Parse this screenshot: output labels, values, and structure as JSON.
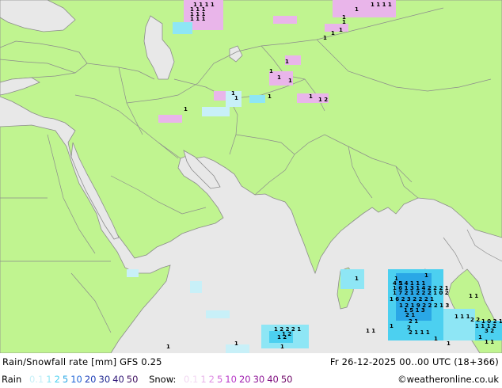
{
  "footer": {
    "title": "Rain/Snowfall rate [mm] GFS 0.25",
    "valid_time": "Fr 26-12-2025 00..00 UTC (18+366)",
    "credit": "©weatheronline.co.uk",
    "rain_label": "Rain",
    "snow_label": "Snow:",
    "rain_scale": [
      {
        "t": "0.1",
        "c": "#c8f0f8"
      },
      {
        "t": "1",
        "c": "#8ee6f5"
      },
      {
        "t": "2",
        "c": "#4cd0f0"
      },
      {
        "t": "5",
        "c": "#2aa7e6"
      },
      {
        "t": "10",
        "c": "#2166d8"
      },
      {
        "t": "20",
        "c": "#2040b8"
      },
      {
        "t": "30",
        "c": "#202890"
      },
      {
        "t": "40",
        "c": "#301878"
      },
      {
        "t": "50",
        "c": "#401060"
      }
    ],
    "snow_scale": [
      {
        "t": "0.1",
        "c": "#f2d8f2"
      },
      {
        "t": "1",
        "c": "#e9b5ea"
      },
      {
        "t": "2",
        "c": "#e090e4"
      },
      {
        "t": "5",
        "c": "#d060d8"
      },
      {
        "t": "10",
        "c": "#b838c8"
      },
      {
        "t": "20",
        "c": "#a020b0"
      },
      {
        "t": "30",
        "c": "#901898"
      },
      {
        "t": "40",
        "c": "#801080"
      },
      {
        "t": "50",
        "c": "#700868"
      }
    ]
  },
  "map": {
    "land_color": "#c0f490",
    "sea_color": "#e8e8e8",
    "border_color": "#8c8c8c",
    "precip_values": [
      "1 1 1 1",
      "1 1 1",
      "1 1 1",
      "1 1 1",
      "1 1 1 1",
      "1",
      "1",
      "1",
      "1",
      "1",
      "1",
      "1",
      "1",
      "1",
      "1",
      "1",
      "1",
      "1 2",
      "1",
      "1",
      "1",
      "1",
      "1",
      "1",
      "1 2",
      "1 2 2 2 1",
      "1 2",
      "1",
      "1",
      "1",
      "1",
      "4 5 4 1 1 1",
      "1 6 1 3 1 4 2 2 2 1",
      "1 7 2 1 2 2 2 1 0 2",
      "1 6 2 3 2 2 2 1",
      "1 2 1 9 2 2 2 1 3",
      "1 5 1 3",
      "2 1",
      "2 1",
      "2",
      "2 1 1 1",
      "1 1",
      "1 1 1",
      "2 2",
      "1 1 1 2",
      "1 0 2 1",
      "3 2",
      "1 1",
      "1",
      "1",
      "1",
      "1",
      "1 1"
    ]
  }
}
